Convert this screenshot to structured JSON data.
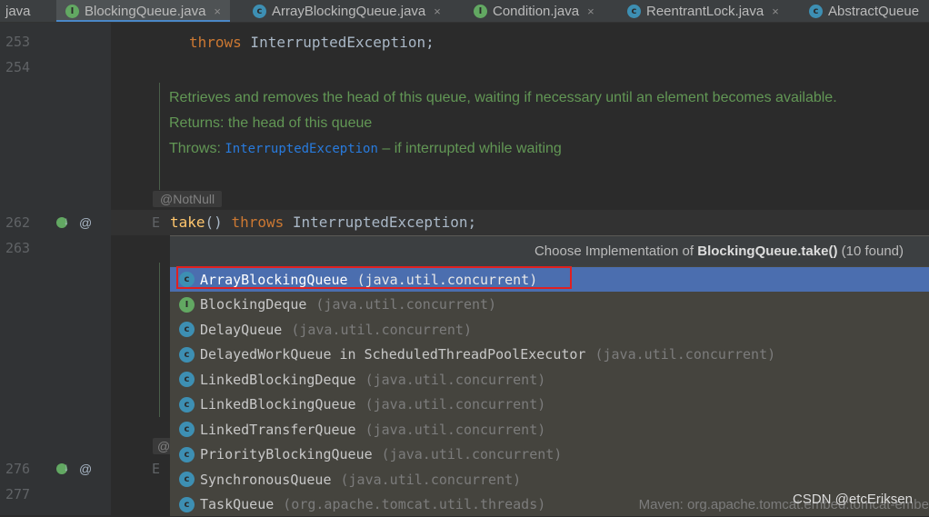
{
  "tabs": [
    {
      "label": "java",
      "icon": "none"
    },
    {
      "label": "BlockingQueue.java",
      "icon": "interface-icon",
      "active": true
    },
    {
      "label": "ArrayBlockingQueue.java",
      "icon": "class-icon"
    },
    {
      "label": "Condition.java",
      "icon": "interface-icon"
    },
    {
      "label": "ReentrantLock.java",
      "icon": "class-icon"
    },
    {
      "label": "AbstractQueue",
      "icon": "class-icon"
    }
  ],
  "tab_close_glyph": "×",
  "icon_letters": {
    "interface": "I",
    "class": "c"
  },
  "line_numbers": {
    "l253": "253",
    "l254": "254",
    "l262": "262",
    "l263": "263",
    "l276": "276",
    "l277": "277"
  },
  "gutter_at": "@",
  "code": {
    "line253_kw": "throws",
    "line253_type": " InterruptedException;",
    "line262_e": "E",
    "line262_fn": "take",
    "line262_parens": "() ",
    "line262_kw": "throws",
    "line262_type": " InterruptedException;",
    "line276_e": "E",
    "annotation": "@NotNull",
    "annotation_partial": "@"
  },
  "doc": {
    "summary": "Retrieves and removes the head of this queue, waiting if necessary until an element becomes available.",
    "returns": "Returns: the head of this queue",
    "throws_label": "Throws: ",
    "throws_link": "InterruptedException",
    "throws_desc": " – if interrupted while waiting"
  },
  "popup": {
    "header_prefix": "Choose Implementation of ",
    "header_method": "BlockingQueue.take()",
    "header_suffix": " (10 found)",
    "items": [
      {
        "name": "ArrayBlockingQueue",
        "pkg": "(java.util.concurrent)",
        "icon": "class-icon",
        "selected": true
      },
      {
        "name": "BlockingDeque",
        "pkg": "(java.util.concurrent)",
        "icon": "interface-icon"
      },
      {
        "name": "DelayQueue",
        "pkg": "(java.util.concurrent)",
        "icon": "class-icon"
      },
      {
        "name": "DelayedWorkQueue in ScheduledThreadPoolExecutor",
        "pkg": "(java.util.concurrent)",
        "icon": "class-icon"
      },
      {
        "name": "LinkedBlockingDeque",
        "pkg": "(java.util.concurrent)",
        "icon": "class-icon"
      },
      {
        "name": "LinkedBlockingQueue",
        "pkg": "(java.util.concurrent)",
        "icon": "class-icon"
      },
      {
        "name": "LinkedTransferQueue",
        "pkg": "(java.util.concurrent)",
        "icon": "class-icon"
      },
      {
        "name": "PriorityBlockingQueue",
        "pkg": "(java.util.concurrent)",
        "icon": "class-icon"
      },
      {
        "name": "SynchronousQueue",
        "pkg": "(java.util.concurrent)",
        "icon": "class-icon"
      },
      {
        "name": "TaskQueue",
        "pkg": "(org.apache.tomcat.util.threads)",
        "icon": "class-icon"
      }
    ],
    "maven_label": "Maven: org.apache.tomcat.embed:tomcat-embe"
  },
  "watermark": "CSDN @etcEriksen",
  "colors": {
    "accent": "#4b6eaf",
    "highlight_box": "#e02020",
    "doc_green": "#629755",
    "keyword": "#cc7832"
  }
}
